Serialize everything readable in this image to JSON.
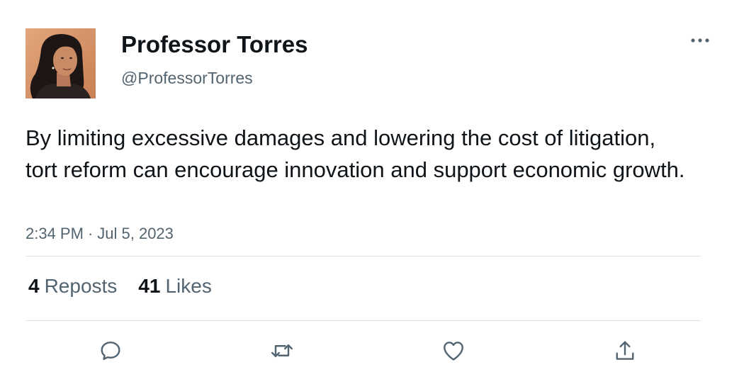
{
  "author": {
    "display_name": "Professor Torres",
    "handle": "@ProfessorTorres",
    "avatar_icon": "profile-photo"
  },
  "tweet": {
    "text": "By limiting excessive damages and lowering the cost of litigation, tort reform can encourage innovation and support economic growth.",
    "time": "2:34 PM",
    "separator": "·",
    "date": "Jul 5, 2023"
  },
  "stats": {
    "reposts_count": "4",
    "reposts_label": "Reposts",
    "likes_count": "41",
    "likes_label": "Likes"
  },
  "actions": {
    "reply_icon": "speech-bubble",
    "repost_icon": "repost-arrows",
    "like_icon": "heart",
    "share_icon": "upload-arrow",
    "more_icon": "ellipsis"
  },
  "colors": {
    "primary_text": "#0f1419",
    "secondary_text": "#536471",
    "divider": "#dfe3e6",
    "icon": "#536471"
  }
}
